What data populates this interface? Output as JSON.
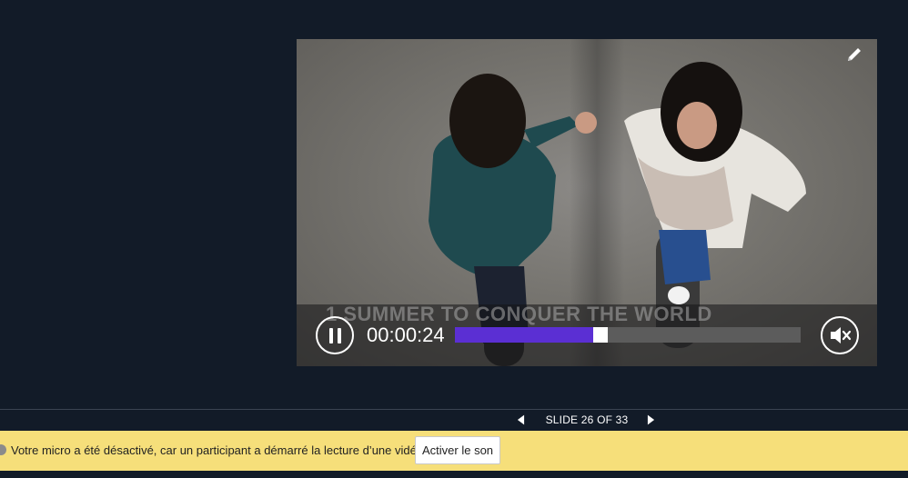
{
  "video": {
    "caption": "1 SUMMER TO CONQUER THE WORLD",
    "timecode": "00:00:24",
    "progress": 0.41,
    "icons": {
      "edit": "pencil-icon",
      "play_state": "pause-icon",
      "volume": "speaker-muted-icon"
    }
  },
  "navigation": {
    "slide_label": "SLIDE 26 OF 33",
    "icons": {
      "prev": "chevron-left-icon",
      "next": "chevron-right-icon"
    }
  },
  "notification": {
    "message": "Votre micro a été désactivé, car un participant a démarré la lecture d’une vidéo.",
    "button_label": "Activer le son"
  },
  "colors": {
    "background": "#121b28",
    "progress_fill": "#5b2fd3",
    "notification_bg": "#f6df7a"
  }
}
